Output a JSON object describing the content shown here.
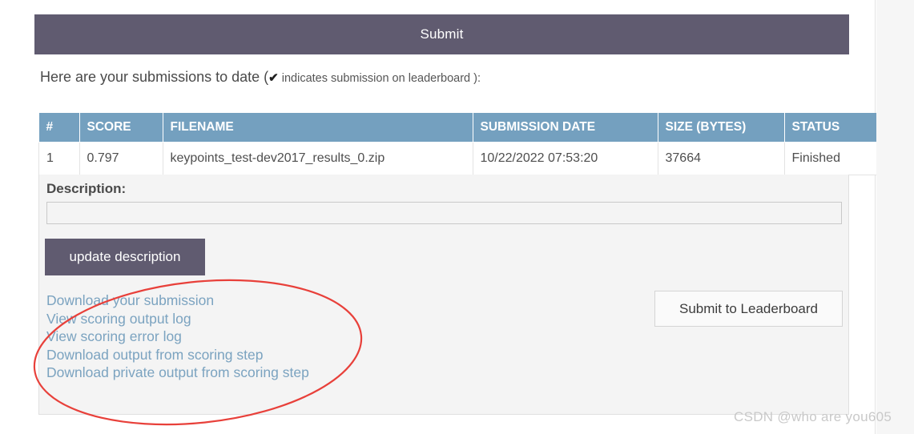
{
  "submit_bar": {
    "label": "Submit"
  },
  "intro": {
    "text": "Here are your submissions to date (",
    "check_glyph": "✔",
    "suffix": " indicates submission on leaderboard ):"
  },
  "table": {
    "columns": [
      "#",
      "SCORE",
      "FILENAME",
      "SUBMISSION DATE",
      "SIZE (BYTES)",
      "STATUS",
      "✔",
      ""
    ],
    "rows": [
      {
        "index": "1",
        "score": "0.797",
        "filename": "keypoints_test-dev2017_results_0.zip",
        "submission_date": "10/22/2022 07:53:20",
        "size_bytes": "37664",
        "status": "Finished",
        "leaderboard_check": "",
        "action": "▬"
      }
    ]
  },
  "detail": {
    "description_label": "Description:",
    "description_value": "",
    "description_placeholder": "",
    "update_button": "update description",
    "links": [
      "Download your submission",
      "View scoring output log",
      "View scoring error log",
      "Download output from scoring step",
      "Download private output from scoring step"
    ],
    "leaderboard_button": "Submit to Leaderboard"
  },
  "annotation": {
    "shape": "ellipse",
    "color": "#e8403a"
  },
  "watermark": {
    "text": "CSDN @who are you605"
  },
  "colors": {
    "submit_bar": "#605b70",
    "table_header": "#74a0bf",
    "link": "#7ba3c0",
    "panel": "#f4f4f4",
    "annotation_red": "#e8403a"
  }
}
